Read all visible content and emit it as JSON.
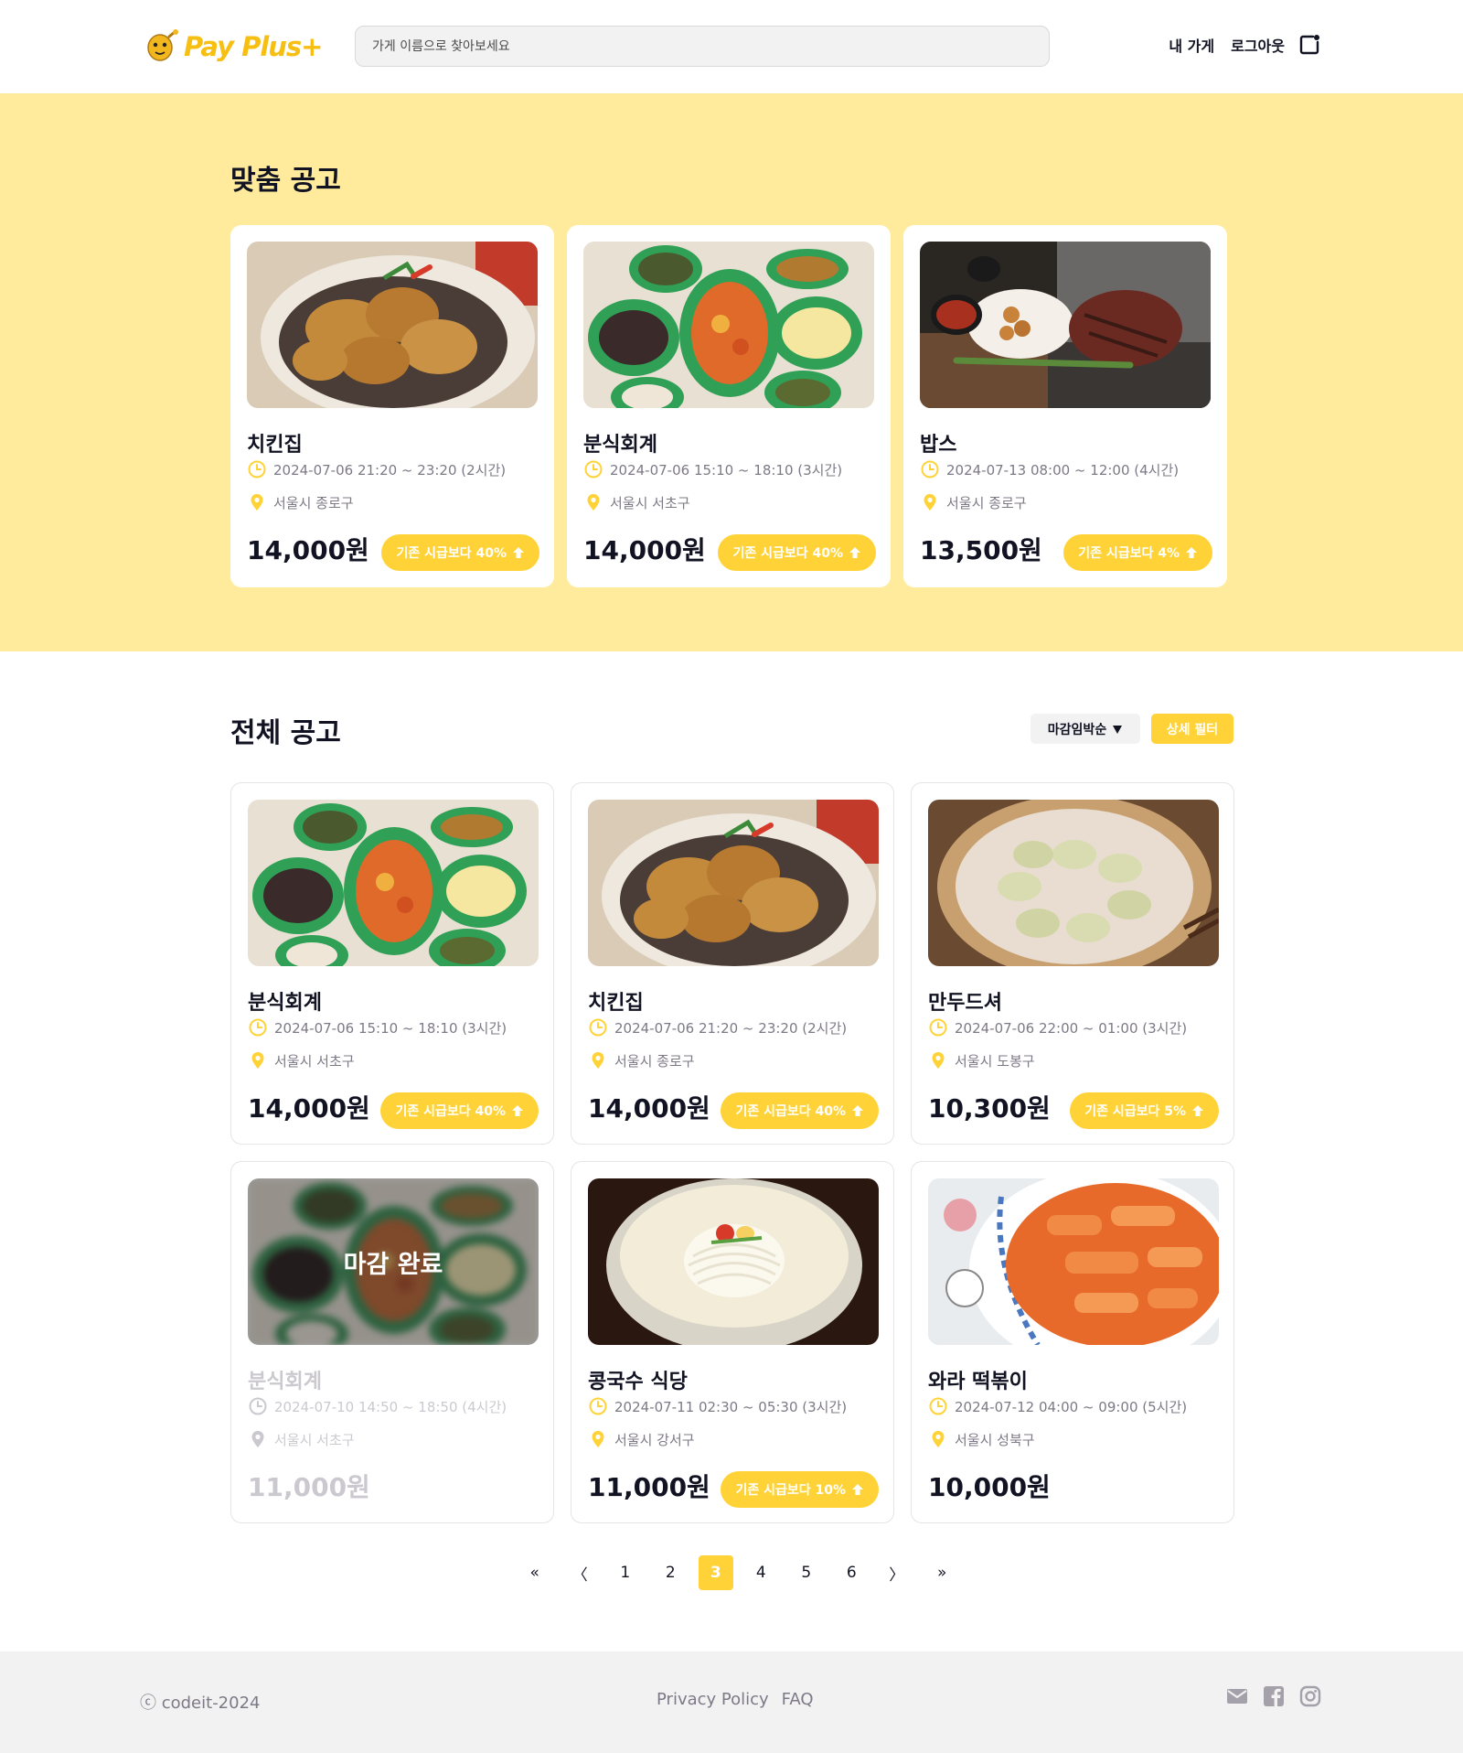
{
  "header": {
    "logo_text": "Pay Plus+",
    "search_placeholder": "가게 이름으로 찾아보세요",
    "my_store": "내 가게",
    "logout": "로그아웃"
  },
  "featured": {
    "title": "맞춤 공고",
    "cards": [
      {
        "name": "치킨집",
        "time": "2024-07-06 21:20 ~ 23:20 (2시간)",
        "location": "서울시 종로구",
        "price": "14,000원",
        "badge": "기존 시급보다 40%",
        "image": "chicken"
      },
      {
        "name": "분식회계",
        "time": "2024-07-06 15:10 ~ 18:10 (3시간)",
        "location": "서울시 서초구",
        "price": "14,000원",
        "badge": "기존 시급보다 40%",
        "image": "bunsik"
      },
      {
        "name": "밥스",
        "time": "2024-07-13 08:00 ~ 12:00 (4시간)",
        "location": "서울시 종로구",
        "price": "13,500원",
        "badge": "기존 시급보다 4%",
        "image": "steak"
      }
    ]
  },
  "all": {
    "title": "전체 공고",
    "sort_label": "마감임박순",
    "filter_label": "상세 필터",
    "cards": [
      {
        "name": "분식회계",
        "time": "2024-07-06 15:10 ~ 18:10 (3시간)",
        "location": "서울시 서초구",
        "price": "14,000원",
        "badge": "기존 시급보다 40%",
        "image": "bunsik"
      },
      {
        "name": "치킨집",
        "time": "2024-07-06 21:20 ~ 23:20 (2시간)",
        "location": "서울시 종로구",
        "price": "14,000원",
        "badge": "기존 시급보다 40%",
        "image": "chicken"
      },
      {
        "name": "만두드셔",
        "time": "2024-07-06 22:00 ~ 01:00 (3시간)",
        "location": "서울시 도봉구",
        "price": "10,300원",
        "badge": "기존 시급보다 5%",
        "image": "dumpling"
      },
      {
        "name": "분식회계",
        "time": "2024-07-10 14:50 ~ 18:50 (4시간)",
        "location": "서울시 서초구",
        "price": "11,000원",
        "badge": "",
        "image": "bunsik",
        "closed": true,
        "closed_label": "마감 완료"
      },
      {
        "name": "콩국수 식당",
        "time": "2024-07-11 02:30 ~ 05:30 (3시간)",
        "location": "서울시 강서구",
        "price": "11,000원",
        "badge": "기존 시급보다 10%",
        "image": "noodle"
      },
      {
        "name": "와라 떡볶이",
        "time": "2024-07-12 04:00 ~ 09:00 (5시간)",
        "location": "서울시 성북구",
        "price": "10,000원",
        "badge": "",
        "image": "tteok"
      }
    ]
  },
  "pagination": {
    "first": "«",
    "prev": "〈",
    "pages": [
      "1",
      "2",
      "3",
      "4",
      "5",
      "6"
    ],
    "active": "3",
    "next": "〉",
    "last": "»"
  },
  "footer": {
    "copyright": "ⓒ codeit-2024",
    "privacy": "Privacy Policy",
    "faq": "FAQ"
  },
  "colors": {
    "accent": "#ffd337",
    "featured_bg": "#ffeb9b",
    "text_primary": "#111322",
    "text_secondary": "#7d7986",
    "disabled": "#cbc9cf"
  },
  "icons": {
    "clock": "clock-icon",
    "location": "location-pin-icon",
    "arrow_up": "arrow-up-icon",
    "logout": "logout-icon",
    "mail": "mail-icon",
    "facebook": "facebook-icon",
    "instagram": "instagram-icon"
  }
}
